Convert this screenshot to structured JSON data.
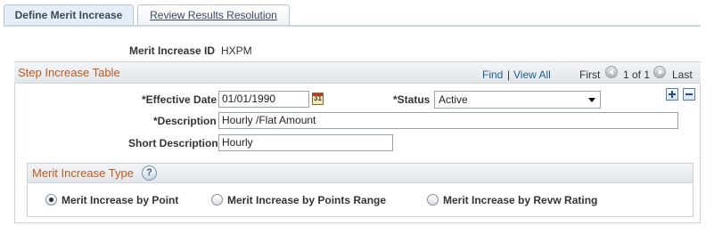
{
  "tabs": {
    "active_label": "Define Merit Increase",
    "inactive_label": "Review Results Resolution"
  },
  "merit_increase": {
    "id_label": "Merit Increase ID",
    "id_value": "HXPM"
  },
  "step_table": {
    "title": "Step Increase Table",
    "nav": {
      "find": "Find",
      "separator": "|",
      "view_all": "View All",
      "first": "First",
      "position": "1 of 1",
      "last": "Last"
    },
    "effective_date_label": "*Effective Date",
    "effective_date_value": "01/01/1990",
    "calendar_icon_glyph": "31",
    "status_label": "*Status",
    "status_value": "Active",
    "description_label": "*Description",
    "description_value": "Hourly /Flat Amount",
    "short_description_label": "Short Description",
    "short_description_value": "Hourly"
  },
  "merit_type": {
    "title": "Merit Increase Type",
    "help_glyph": "?",
    "options": [
      {
        "label": "Merit Increase by Point",
        "selected": true
      },
      {
        "label": "Merit Increase by Points Range",
        "selected": false
      },
      {
        "label": "Merit Increase by Revw Rating",
        "selected": false
      }
    ]
  },
  "icons": {
    "add_row": "plus-icon",
    "delete_row": "minus-icon",
    "first": "arrow-left-icon",
    "last": "arrow-right-icon",
    "calendar": "calendar-icon",
    "help": "help-icon"
  }
}
